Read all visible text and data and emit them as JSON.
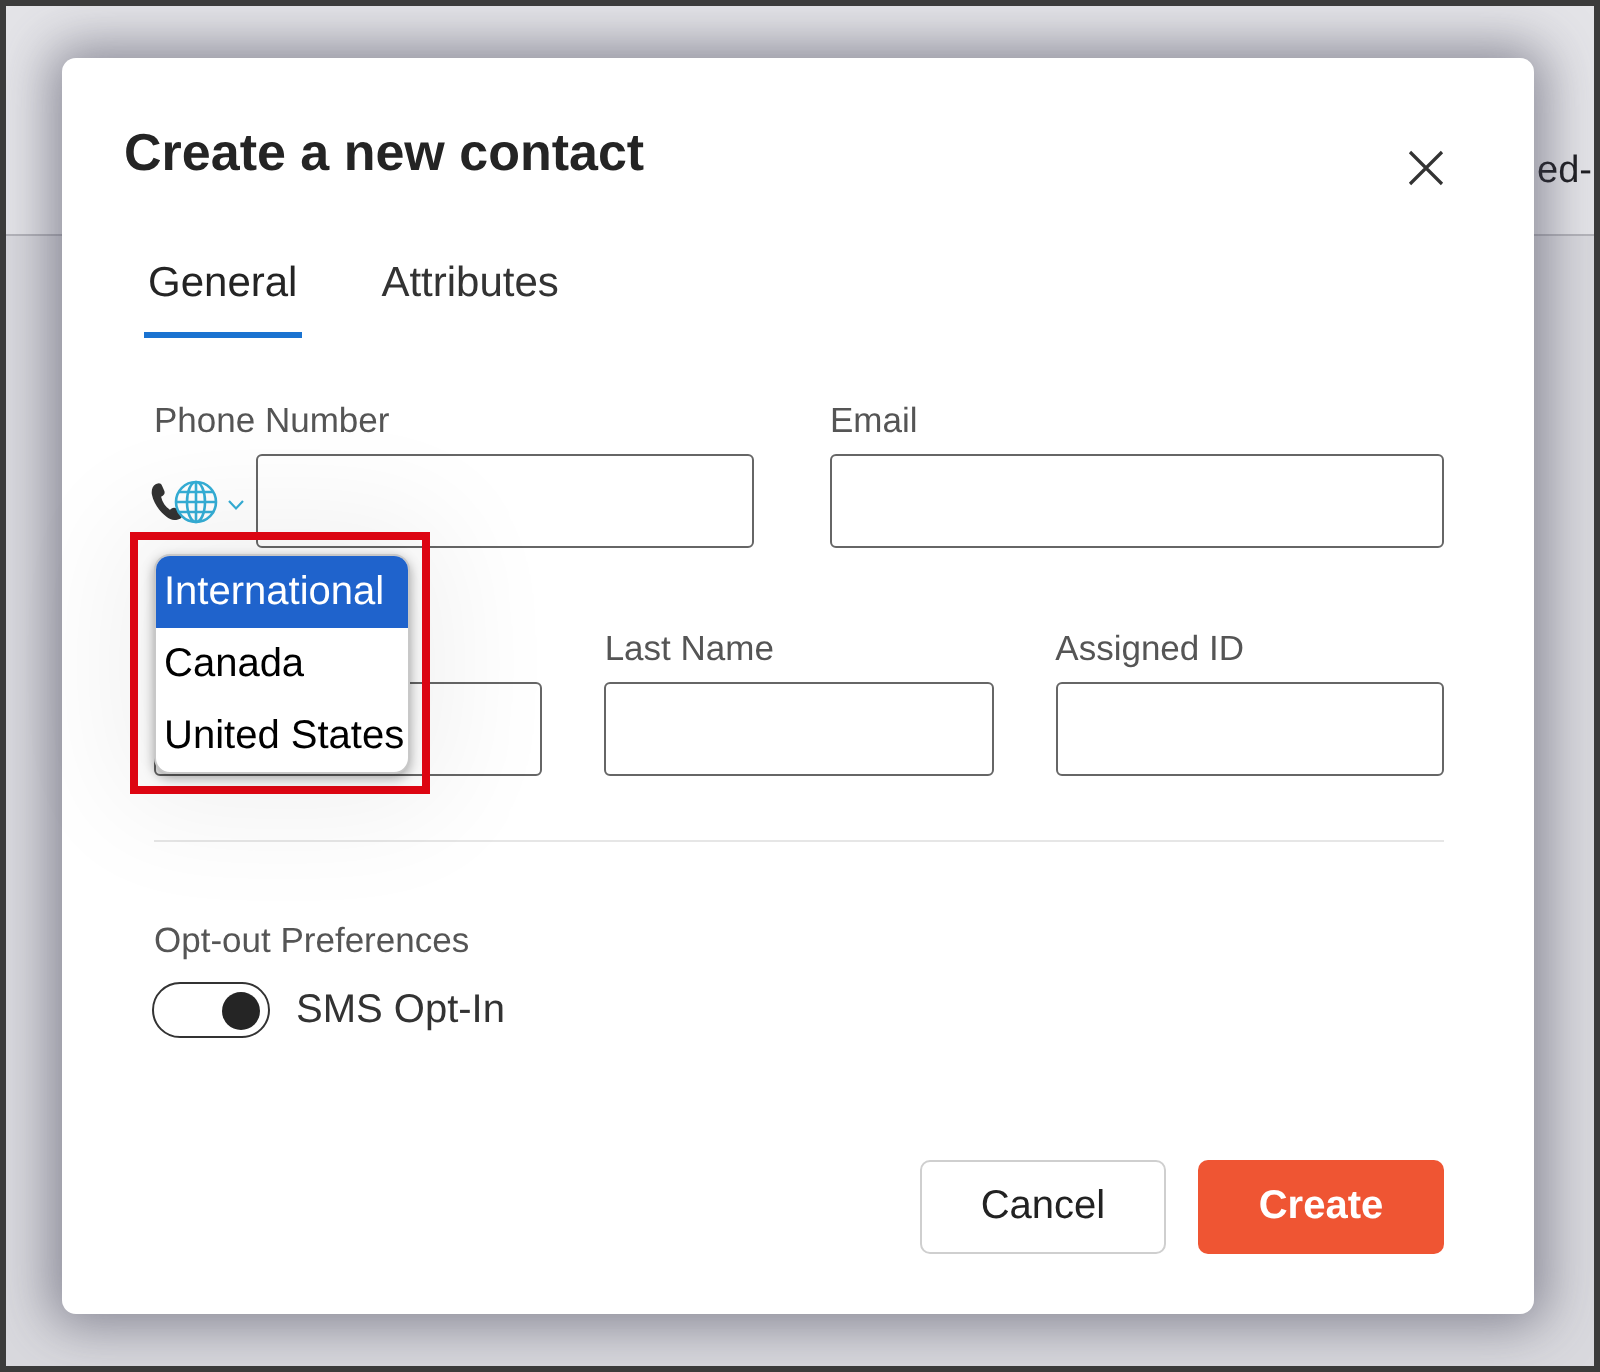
{
  "background": {
    "header_text": "ed-"
  },
  "dialog": {
    "title": "Create a new contact"
  },
  "tabs": [
    {
      "label": "General",
      "selected": true
    },
    {
      "label": "Attributes",
      "selected": false
    }
  ],
  "contact_row": {
    "phone": {
      "label": "Phone Number"
    },
    "email": {
      "label": "Email"
    }
  },
  "country_menu": {
    "highlighted": true,
    "options": [
      {
        "label": "International",
        "selected": true
      },
      {
        "label": "Canada",
        "selected": false
      },
      {
        "label": "United States",
        "selected": false
      }
    ]
  },
  "name_row": [
    {
      "kind": "covered"
    },
    {
      "kind": "text",
      "label": "Last Name"
    },
    {
      "kind": "text",
      "label": "Assigned ID"
    }
  ],
  "opt_out": {
    "label": "Opt-out Preferences",
    "toggles": [
      {
        "label": "SMS Opt-In",
        "on": true
      }
    ]
  },
  "buttons": [
    {
      "label": "Cancel",
      "kind": "secondary"
    },
    {
      "label": "Create",
      "kind": "primary"
    }
  ]
}
